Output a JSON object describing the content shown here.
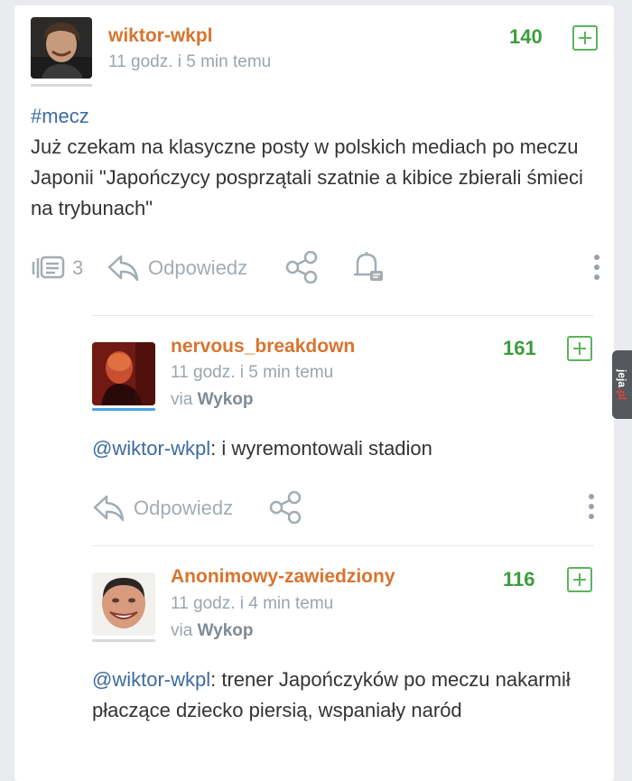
{
  "entry": {
    "author": "wiktor-wkpl",
    "time": "11 godz. i 5 min temu",
    "votes": "140",
    "hashtag": "#mecz",
    "text": "Już czekam na klasyczne posty w polskich mediach po meczu Japonii \"Japończycy posprzątali szatnie a kibice zbierali śmieci na trybunach\"",
    "comments_count": "3",
    "reply_label": "Odpowiedz",
    "icons": [
      "comments-icon",
      "reply-icon",
      "share-icon",
      "bell-icon",
      "more-icon"
    ],
    "avatar_line_color": "#d6d9dc"
  },
  "comments": [
    {
      "author": "nervous_breakdown",
      "time": "11 godz. i 5 min temu",
      "via_prefix": "via",
      "via_app": "Wykop",
      "votes": "161",
      "mention": "@wiktor-wkpl",
      "text": ": i wyremontowali stadion",
      "reply_label": "Odpowiedz",
      "avatar_line_color": "#4aa3df"
    },
    {
      "author": "Anonimowy-zawiedziony",
      "time": "11 godz. i 4 min temu",
      "via_prefix": "via",
      "via_app": "Wykop",
      "votes": "116",
      "mention": "@wiktor-wkpl",
      "text": ": trener Japończyków po meczu nakarmił płaczące dziecko piersią, wspaniały naród",
      "avatar_line_color": "#d6d9dc"
    }
  ],
  "colors": {
    "author": "#d8742e",
    "votes": "#3d9c3d",
    "link": "#3d6aa1",
    "muted": "#9aa5ad"
  },
  "watermark": {
    "text": "jeja",
    "suffix": ".pl"
  }
}
